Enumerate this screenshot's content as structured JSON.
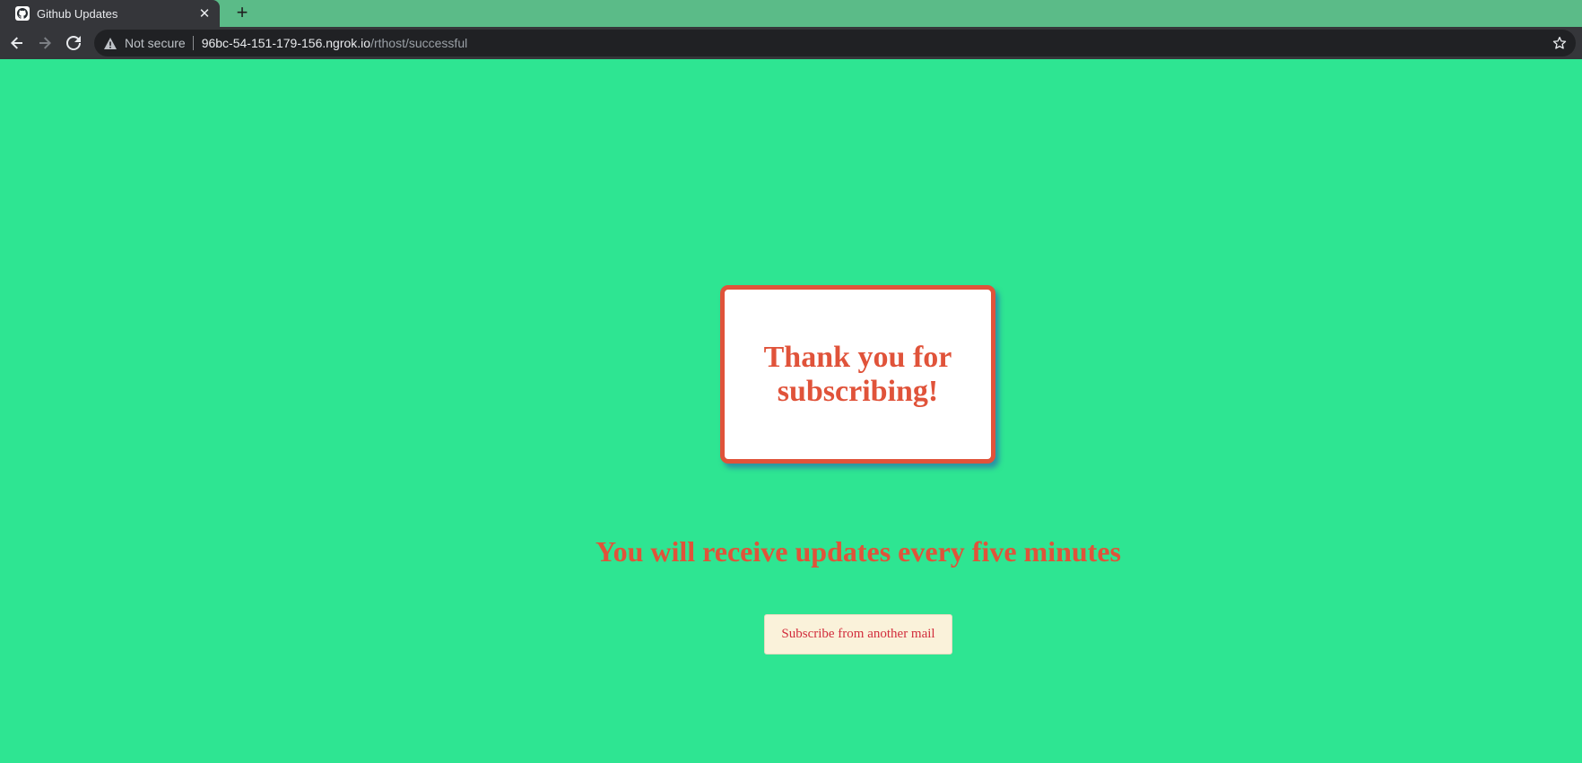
{
  "browser": {
    "tab": {
      "title": "Github Updates",
      "favicon": "github-icon",
      "close_label": "✕"
    },
    "new_tab_label": "+",
    "nav": {
      "back": "back-arrow-icon",
      "forward": "forward-arrow-icon",
      "reload": "reload-icon"
    },
    "address": {
      "security_label": "Not secure",
      "host": "96bc-54-151-179-156.ngrok.io",
      "path": "/rthost/successful"
    },
    "bookmark_icon": "star-icon"
  },
  "page": {
    "background_color": "#2ee592",
    "accent_color": "#e0533a",
    "card_title": "Thank you for subscribing!",
    "subtitle": "You will receive updates every five minutes",
    "button_label": "Subscribe from another mail"
  }
}
